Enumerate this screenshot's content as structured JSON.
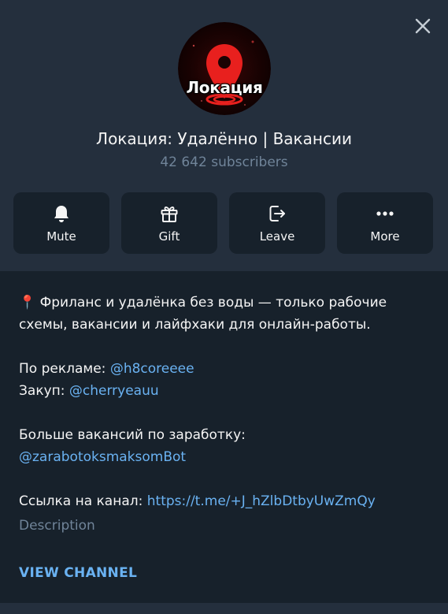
{
  "header": {
    "avatar_label": "Локация",
    "channel_name": "Локация: Удалённо | Вакансии",
    "subscribers": "42 642 subscribers",
    "avatar_icon": "location-pin-icon",
    "close_icon": "close-icon"
  },
  "actions": [
    {
      "label": "Mute",
      "icon": "bell-icon"
    },
    {
      "label": "Gift",
      "icon": "gift-icon"
    },
    {
      "label": "Leave",
      "icon": "leave-icon"
    },
    {
      "label": "More",
      "icon": "more-dots-icon"
    }
  ],
  "description": {
    "emoji": "📍",
    "intro_line1": "Фриланс и удалёнка без воды — только рабочие",
    "intro_line2": "схемы, вакансии и лайфхаки для онлайн-работы.",
    "ads_label": "По рекламе:",
    "ads_link": "@h8coreeee",
    "purchase_label": "Закуп:",
    "purchase_link": "@cherryeauu",
    "more_jobs_label": "Больше вакансий по заработку:",
    "more_jobs_link": "@zarabotoksmaksomBot",
    "channel_link_label": "Ссылка на канал:",
    "channel_link": "https://t.me/+J_hZlbDtbyUwZmQy",
    "caption": "Description"
  },
  "view_channel": "VIEW CHANNEL",
  "colors": {
    "background": "#17212b",
    "header_bg": "#242f3d",
    "accent": "#6ab2f2",
    "muted": "#708499",
    "pin_red": "#e8201e"
  }
}
